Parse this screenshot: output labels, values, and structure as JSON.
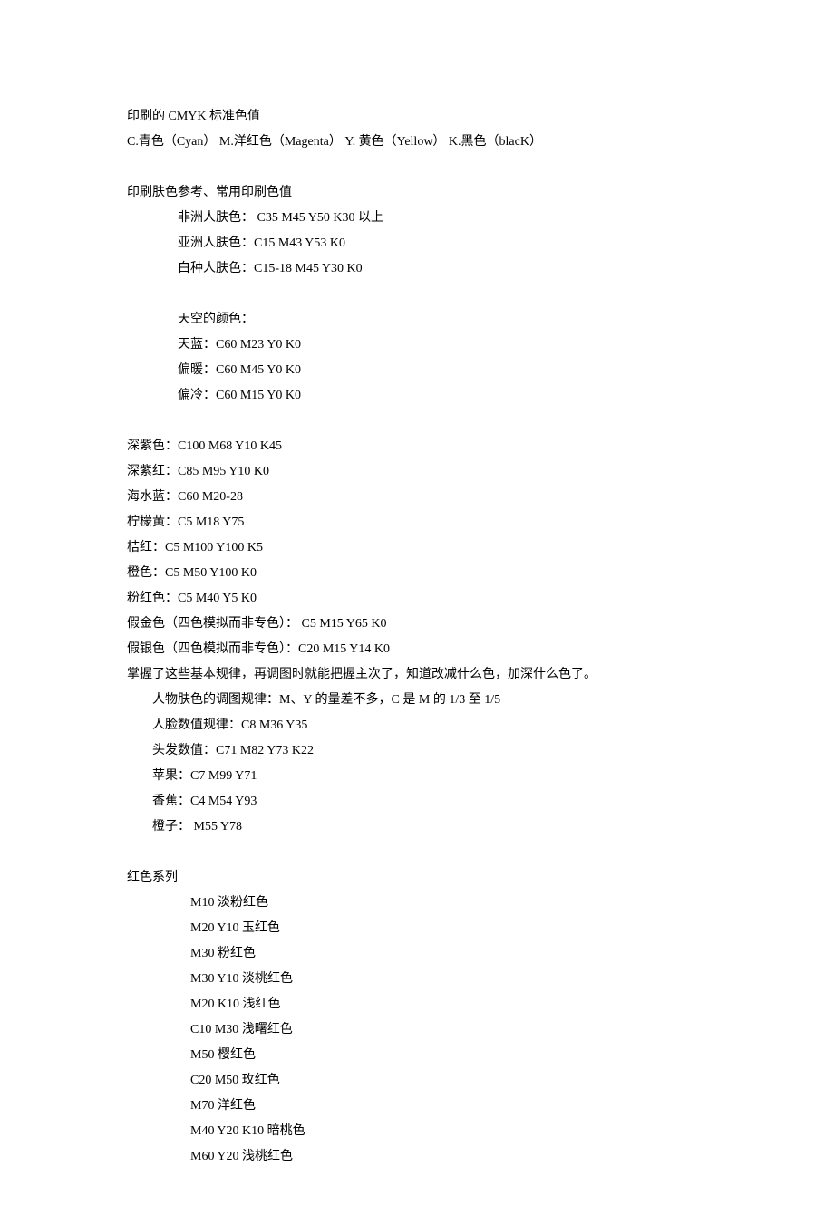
{
  "intro": {
    "title": "印刷的 CMYK 标准色值",
    "channels": "C.青色（Cyan） M.洋红色（Magenta） Y. 黄色（Yellow） K.黑色（blacK）"
  },
  "skin_section": {
    "heading": "印刷肤色参考、常用印刷色值",
    "items": [
      "非洲人肤色： C35 M45 Y50 K30 以上",
      "亚洲人肤色：C15 M43 Y53 K0",
      "白种人肤色：C15-18 M45 Y30 K0"
    ]
  },
  "sky_section": {
    "heading": "天空的颜色：",
    "items": [
      "天蓝：C60 M23 Y0 K0",
      "偏暖：C60 M45 Y0 K0",
      "偏冷：C60 M15 Y0 K0"
    ]
  },
  "general_colors": [
    "深紫色：C100 M68 Y10 K45",
    "深紫红：C85 M95 Y10 K0",
    "海水蓝：C60 M20-28",
    "柠檬黄：C5 M18 Y75",
    "桔红：C5 M100 Y100 K5",
    "橙色：C5 M50 Y100 K0",
    "粉红色：C5 M40 Y5 K0",
    "假金色（四色模拟而非专色）： C5 M15 Y65 K0",
    "假银色（四色模拟而非专色）：C20 M15 Y14 K0",
    "掌握了这些基本规律，再调图时就能把握主次了，知道改减什么色，加深什么色了。"
  ],
  "rules": [
    "人物肤色的调图规律：M、Y 的量差不多，C 是 M 的 1/3 至 1/5",
    "人脸数值规律：C8 M36 Y35",
    "头发数值：C71 M82 Y73 K22",
    "苹果：C7 M99 Y71",
    "香蕉：C4 M54 Y93",
    "橙子： M55 Y78"
  ],
  "red_series": {
    "heading": "红色系列",
    "items": [
      "M10 淡粉红色",
      "M20 Y10 玉红色",
      "M30 粉红色",
      "M30 Y10 淡桃红色",
      "M20 K10 浅红色",
      "C10 M30 浅曙红色",
      "M50 樱红色",
      "C20 M50 玫红色",
      "M70 洋红色",
      "M40 Y20 K10 暗桃色",
      "M60 Y20 浅桃红色"
    ]
  }
}
